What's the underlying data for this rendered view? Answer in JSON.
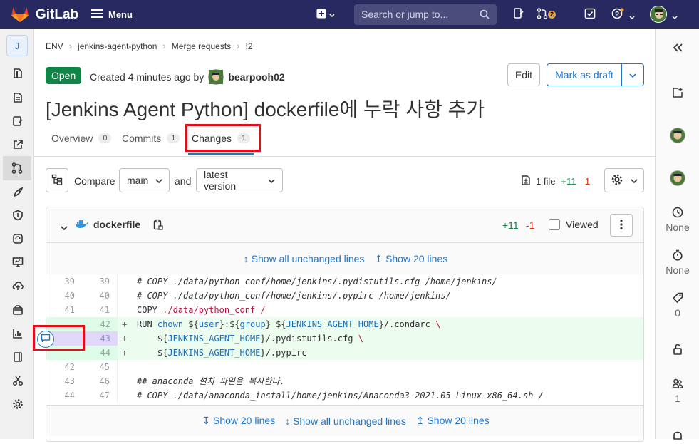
{
  "nav": {
    "brand": "GitLab",
    "menu_label": "Menu",
    "search_placeholder": "Search or jump to...",
    "mr_count": "2"
  },
  "sidebar": {
    "project_initial": "J"
  },
  "breadcrumb": [
    "ENV",
    "jenkins-agent-python",
    "Merge requests",
    "!2"
  ],
  "mr": {
    "status": "Open",
    "created_text": "Created 4 minutes ago by",
    "author": "bearpooh02",
    "edit_label": "Edit",
    "draft_label": "Mark as draft",
    "title": "[Jenkins Agent Python] dockerfile에 누락 사항 추가"
  },
  "tabs": [
    {
      "label": "Overview",
      "count": "0"
    },
    {
      "label": "Commits",
      "count": "1"
    },
    {
      "label": "Changes",
      "count": "1"
    }
  ],
  "compare": {
    "compare_label": "Compare",
    "base": "main",
    "and_label": "and",
    "version": "latest version",
    "files_label": "1 file",
    "additions": "+11",
    "deletions": "-1"
  },
  "file": {
    "name": "dockerfile",
    "additions": "+11",
    "deletions": "-1",
    "viewed_label": "Viewed"
  },
  "expand_top": {
    "show_all": "Show all unchanged lines",
    "show_20": "Show 20 lines"
  },
  "expand_bottom": {
    "show_20_down": "Show 20 lines",
    "show_all": "Show all unchanged lines",
    "show_20_up": "Show 20 lines"
  },
  "diff_lines": [
    {
      "old": "39",
      "new": "39",
      "marker": "",
      "type": "ctx"
    },
    {
      "old": "40",
      "new": "40",
      "marker": "",
      "type": "ctx"
    },
    {
      "old": "41",
      "new": "41",
      "marker": "",
      "type": "ctx"
    },
    {
      "old": "",
      "new": "42",
      "marker": "+",
      "type": "add"
    },
    {
      "old": "",
      "new": "43",
      "marker": "+",
      "type": "add"
    },
    {
      "old": "",
      "new": "44",
      "marker": "+",
      "type": "add"
    },
    {
      "old": "42",
      "new": "45",
      "marker": "",
      "type": "ctx"
    },
    {
      "old": "43",
      "new": "46",
      "marker": "",
      "type": "ctx"
    },
    {
      "old": "44",
      "new": "47",
      "marker": "",
      "type": "ctx"
    }
  ],
  "code": {
    "l1": "# COPY ./data/python_conf/home/jenkins/.pydistutils.cfg /home/jenkins/",
    "l2": "# COPY ./data/python_conf/home/jenkins/.pypirc /home/jenkins/",
    "l3_kw": "COPY",
    "l3_path": "./data/python_conf /",
    "l4_kw": "RUN",
    "l4_cmd": "chown",
    "l4_a": "${",
    "l4_user": "user",
    "l4_b": "}:${",
    "l4_group": "group",
    "l4_c": "} ${",
    "l4_home": "JENKINS_AGENT_HOME",
    "l4_d": "}/.condarc",
    "l4_bs": "\\",
    "l5_a": "${",
    "l5_home": "JENKINS_AGENT_HOME",
    "l5_b": "}/.pydistutils.cfg",
    "l5_bs": "\\",
    "l6_a": "${",
    "l6_home": "JENKINS_AGENT_HOME",
    "l6_b": "}/.pypirc",
    "l8": "## anaconda 설치 파일을 복사한다.",
    "l9": "# COPY ./data/anaconda_install/home/jenkins/Anaconda3-2021.05-Linux-x86_64.sh /"
  },
  "right_sidebar": {
    "time_estimate": "None",
    "time_spent": "None",
    "labels_count": "0",
    "participants_count": "1"
  },
  "colors": {
    "navbar": "#292961",
    "open_badge": "#108548",
    "link": "#1f75cb",
    "added": "#108548",
    "deleted": "#dd2b0e",
    "highlight": "#e0101a"
  }
}
